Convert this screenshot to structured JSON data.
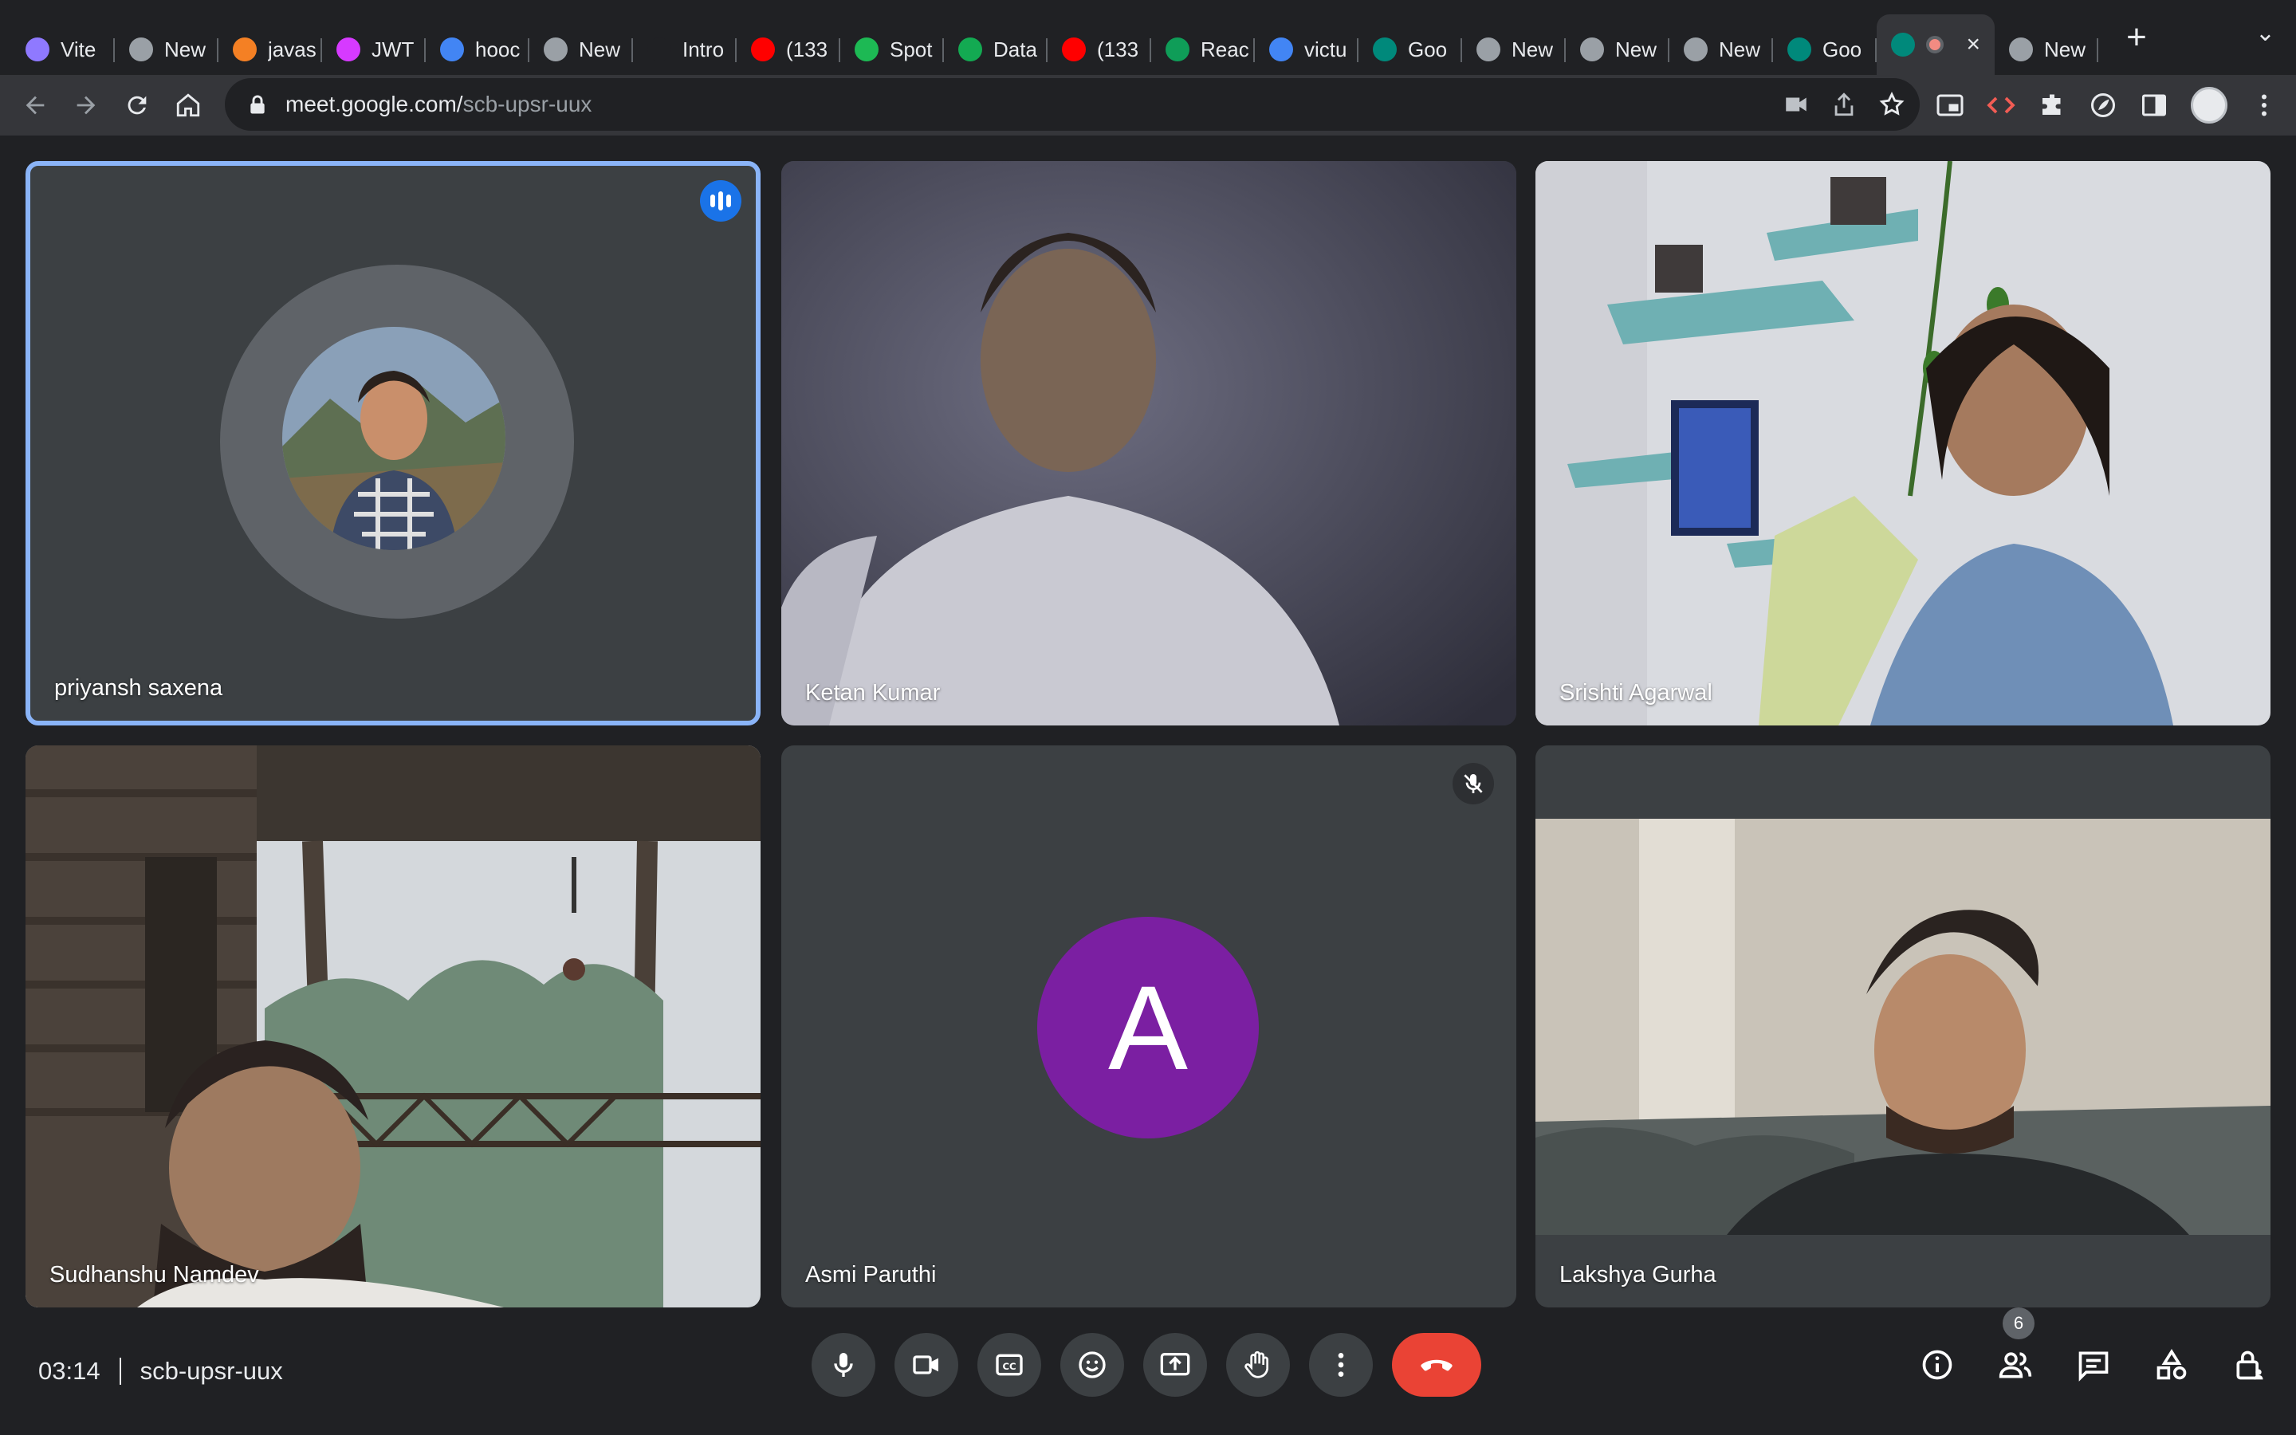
{
  "browser": {
    "tabs": [
      {
        "label": "Vite",
        "icon": "vite-icon",
        "color": "#8f79ff"
      },
      {
        "label": "New",
        "icon": "chrome-icon",
        "color": "#9aa0a6"
      },
      {
        "label": "javas",
        "icon": "stackoverflow-icon",
        "color": "#f48024"
      },
      {
        "label": "JWT",
        "icon": "jwt-icon",
        "color": "#d63aff"
      },
      {
        "label": "hooc",
        "icon": "google-icon",
        "color": "#4285f4"
      },
      {
        "label": "New",
        "icon": "chrome-icon",
        "color": "#9aa0a6"
      },
      {
        "label": "Intro",
        "icon": "medium-icon",
        "color": "#202124"
      },
      {
        "label": "(133",
        "icon": "youtube-icon",
        "color": "#ff0000"
      },
      {
        "label": "Spot",
        "icon": "spotify-icon",
        "color": "#1db954"
      },
      {
        "label": "Data",
        "icon": "mongodb-icon",
        "color": "#13aa52"
      },
      {
        "label": "(133",
        "icon": "youtube-icon",
        "color": "#ff0000"
      },
      {
        "label": "Reac",
        "icon": "w-icon",
        "color": "#0f9d58"
      },
      {
        "label": "victu",
        "icon": "google-icon",
        "color": "#4285f4"
      },
      {
        "label": "Goo",
        "icon": "meet-icon",
        "color": "#00897b"
      },
      {
        "label": "New",
        "icon": "chrome-icon",
        "color": "#9aa0a6"
      },
      {
        "label": "New",
        "icon": "chrome-icon",
        "color": "#9aa0a6"
      },
      {
        "label": "New",
        "icon": "chrome-icon",
        "color": "#9aa0a6"
      },
      {
        "label": "Goo",
        "icon": "meet-icon",
        "color": "#00897b"
      },
      {
        "label": "",
        "icon": "meet-icon",
        "color": "#00897b",
        "active": true,
        "recording": true
      },
      {
        "label": "New",
        "icon": "chrome-icon",
        "color": "#9aa0a6"
      }
    ],
    "url_host": "meet.google.com/",
    "url_path": "scb-upsr-uux"
  },
  "meet": {
    "participants": [
      {
        "name": "priyansh saxena",
        "speaking": true
      },
      {
        "name": "Ketan Kumar"
      },
      {
        "name": "Srishti Agarwal"
      },
      {
        "name": "Sudhanshu Namdev"
      },
      {
        "name": "Asmi Paruthi",
        "muted": true,
        "initial": "A",
        "avatar_color": "#7b1fa2"
      },
      {
        "name": "Lakshya Gurha"
      }
    ],
    "time": "03:14",
    "meeting_code": "scb-upsr-uux",
    "people_count": "6",
    "colors": {
      "end_call": "#ea4335",
      "speaking_border": "#8ab4f8",
      "speaking_badge": "#1a73e8"
    }
  }
}
